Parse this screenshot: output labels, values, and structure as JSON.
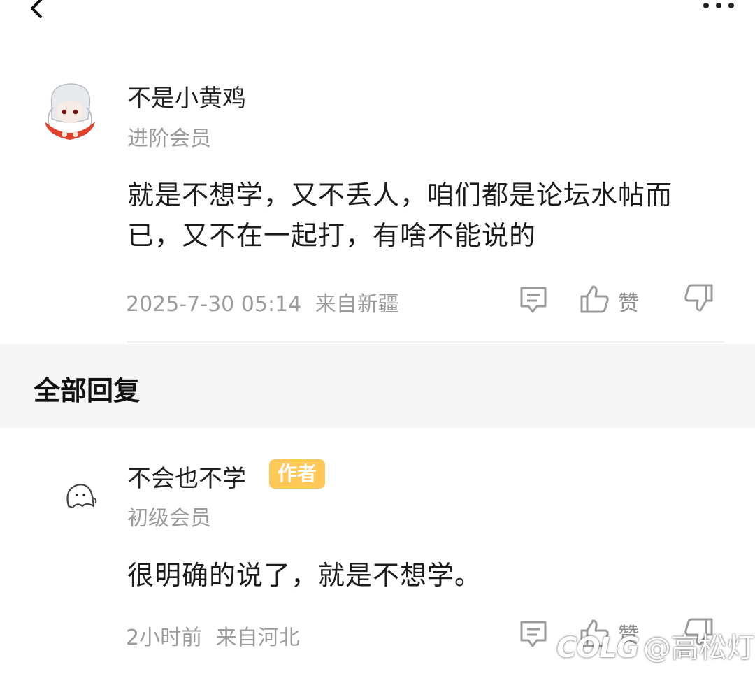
{
  "header": {
    "back_icon": "chevron-left-icon",
    "more_icon": "more-dots-icon"
  },
  "post": {
    "username": "不是小黄鸡",
    "level": "进阶会员",
    "content": "就是不想学，又不丢人，咱们都是论坛水帖而已，又不在一起打，有啥不能说的",
    "timestamp": "2025-7-30 05:14",
    "location": "来自新疆",
    "like_label": "赞"
  },
  "replies_section": {
    "title": "全部回复"
  },
  "reply": {
    "username": "不会也不学",
    "badge": "作者",
    "level": "初级会员",
    "content": "很明确的说了，就是不想学。",
    "timestamp": "2小时前",
    "location": "来自河北",
    "like_label": "赞"
  },
  "watermark": {
    "logo": "COLG",
    "text": "@高松灯"
  },
  "colors": {
    "badge": "#ffc857",
    "section_bg": "#f5f5f5",
    "meta_text": "#9c9c9c"
  }
}
